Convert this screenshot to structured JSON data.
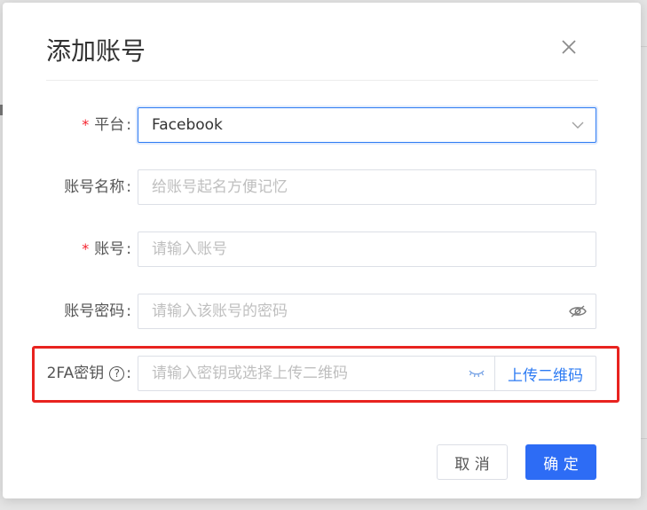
{
  "dialog": {
    "title": "添加账号",
    "close_icon": "close-icon"
  },
  "form": {
    "platform": {
      "label": "平台",
      "required_mark": "*",
      "value": "Facebook",
      "icon": "chevron-down-icon"
    },
    "account_name": {
      "label": "账号名称",
      "value": "",
      "placeholder": "给账号起名方便记忆"
    },
    "account": {
      "label": "账号",
      "required_mark": "*",
      "value": "",
      "placeholder": "请输入账号"
    },
    "password": {
      "label": "账号密码",
      "value": "",
      "placeholder": "请输入该账号的密码",
      "icon": "eye-off-icon"
    },
    "twofa": {
      "label": "2FA密钥",
      "help_icon": "question-circle-icon",
      "value": "",
      "placeholder": "请输入密钥或选择上传二维码",
      "toggle_icon": "eye-closed-icon",
      "upload_label": "上传二维码"
    },
    "colon": ":"
  },
  "footer": {
    "cancel_label": "取 消",
    "ok_label": "确 定"
  },
  "colors": {
    "primary": "#2d6cf5",
    "required": "#f5222d",
    "highlight": "#e8231f"
  }
}
